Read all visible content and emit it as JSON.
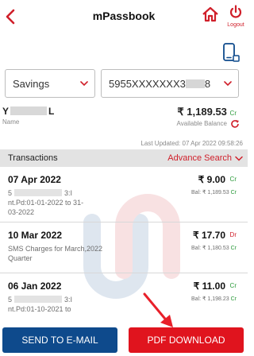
{
  "header": {
    "title": "mPassbook",
    "logout_label": "Logout"
  },
  "account": {
    "type_selected": "Savings",
    "number_prefix": "5955XXXXXXX3",
    "number_suffix": "8",
    "name_start": "Y",
    "name_end": "L",
    "name_label": "Name",
    "balance": "₹ 1,189.53",
    "balance_type": "Cr",
    "balance_label": "Available Balance",
    "last_updated": "Last Updated: 07 Apr 2022 09:58:26"
  },
  "transactions": {
    "title": "Transactions",
    "advance_search": "Advance Search",
    "items": [
      {
        "date": "07 Apr 2022",
        "amount": "₹ 9.00",
        "type": "Cr",
        "desc_line1_start": "5",
        "desc_line1_end": "3:I",
        "desc_rest": "nt.Pd:01-01-2022 to 31-03-2022",
        "balance": "Bal: ₹ 1,189.53",
        "balance_type": "Cr"
      },
      {
        "date": "10 Mar 2022",
        "amount": "₹ 17.70",
        "type": "Dr",
        "desc_full": "SMS Charges for March,2022 Quarter",
        "balance": "Bal: ₹ 1,180.53",
        "balance_type": "Cr"
      },
      {
        "date": "06 Jan 2022",
        "amount": "₹ 11.00",
        "type": "Cr",
        "desc_line1_start": "5",
        "desc_line1_end": "3:I",
        "desc_rest": "nt.Pd:01-10-2021 to",
        "balance": "Bal: ₹ 1,198.23",
        "balance_type": "Cr"
      }
    ]
  },
  "actions": {
    "send_email": "SEND TO E-MAIL",
    "pdf_download": "PDF DOWNLOAD"
  },
  "colors": {
    "brand_red": "#d01f2a",
    "email_blue": "#0e4a8c",
    "pdf_red": "#e0141e",
    "credit_green": "#2a9a3a"
  }
}
